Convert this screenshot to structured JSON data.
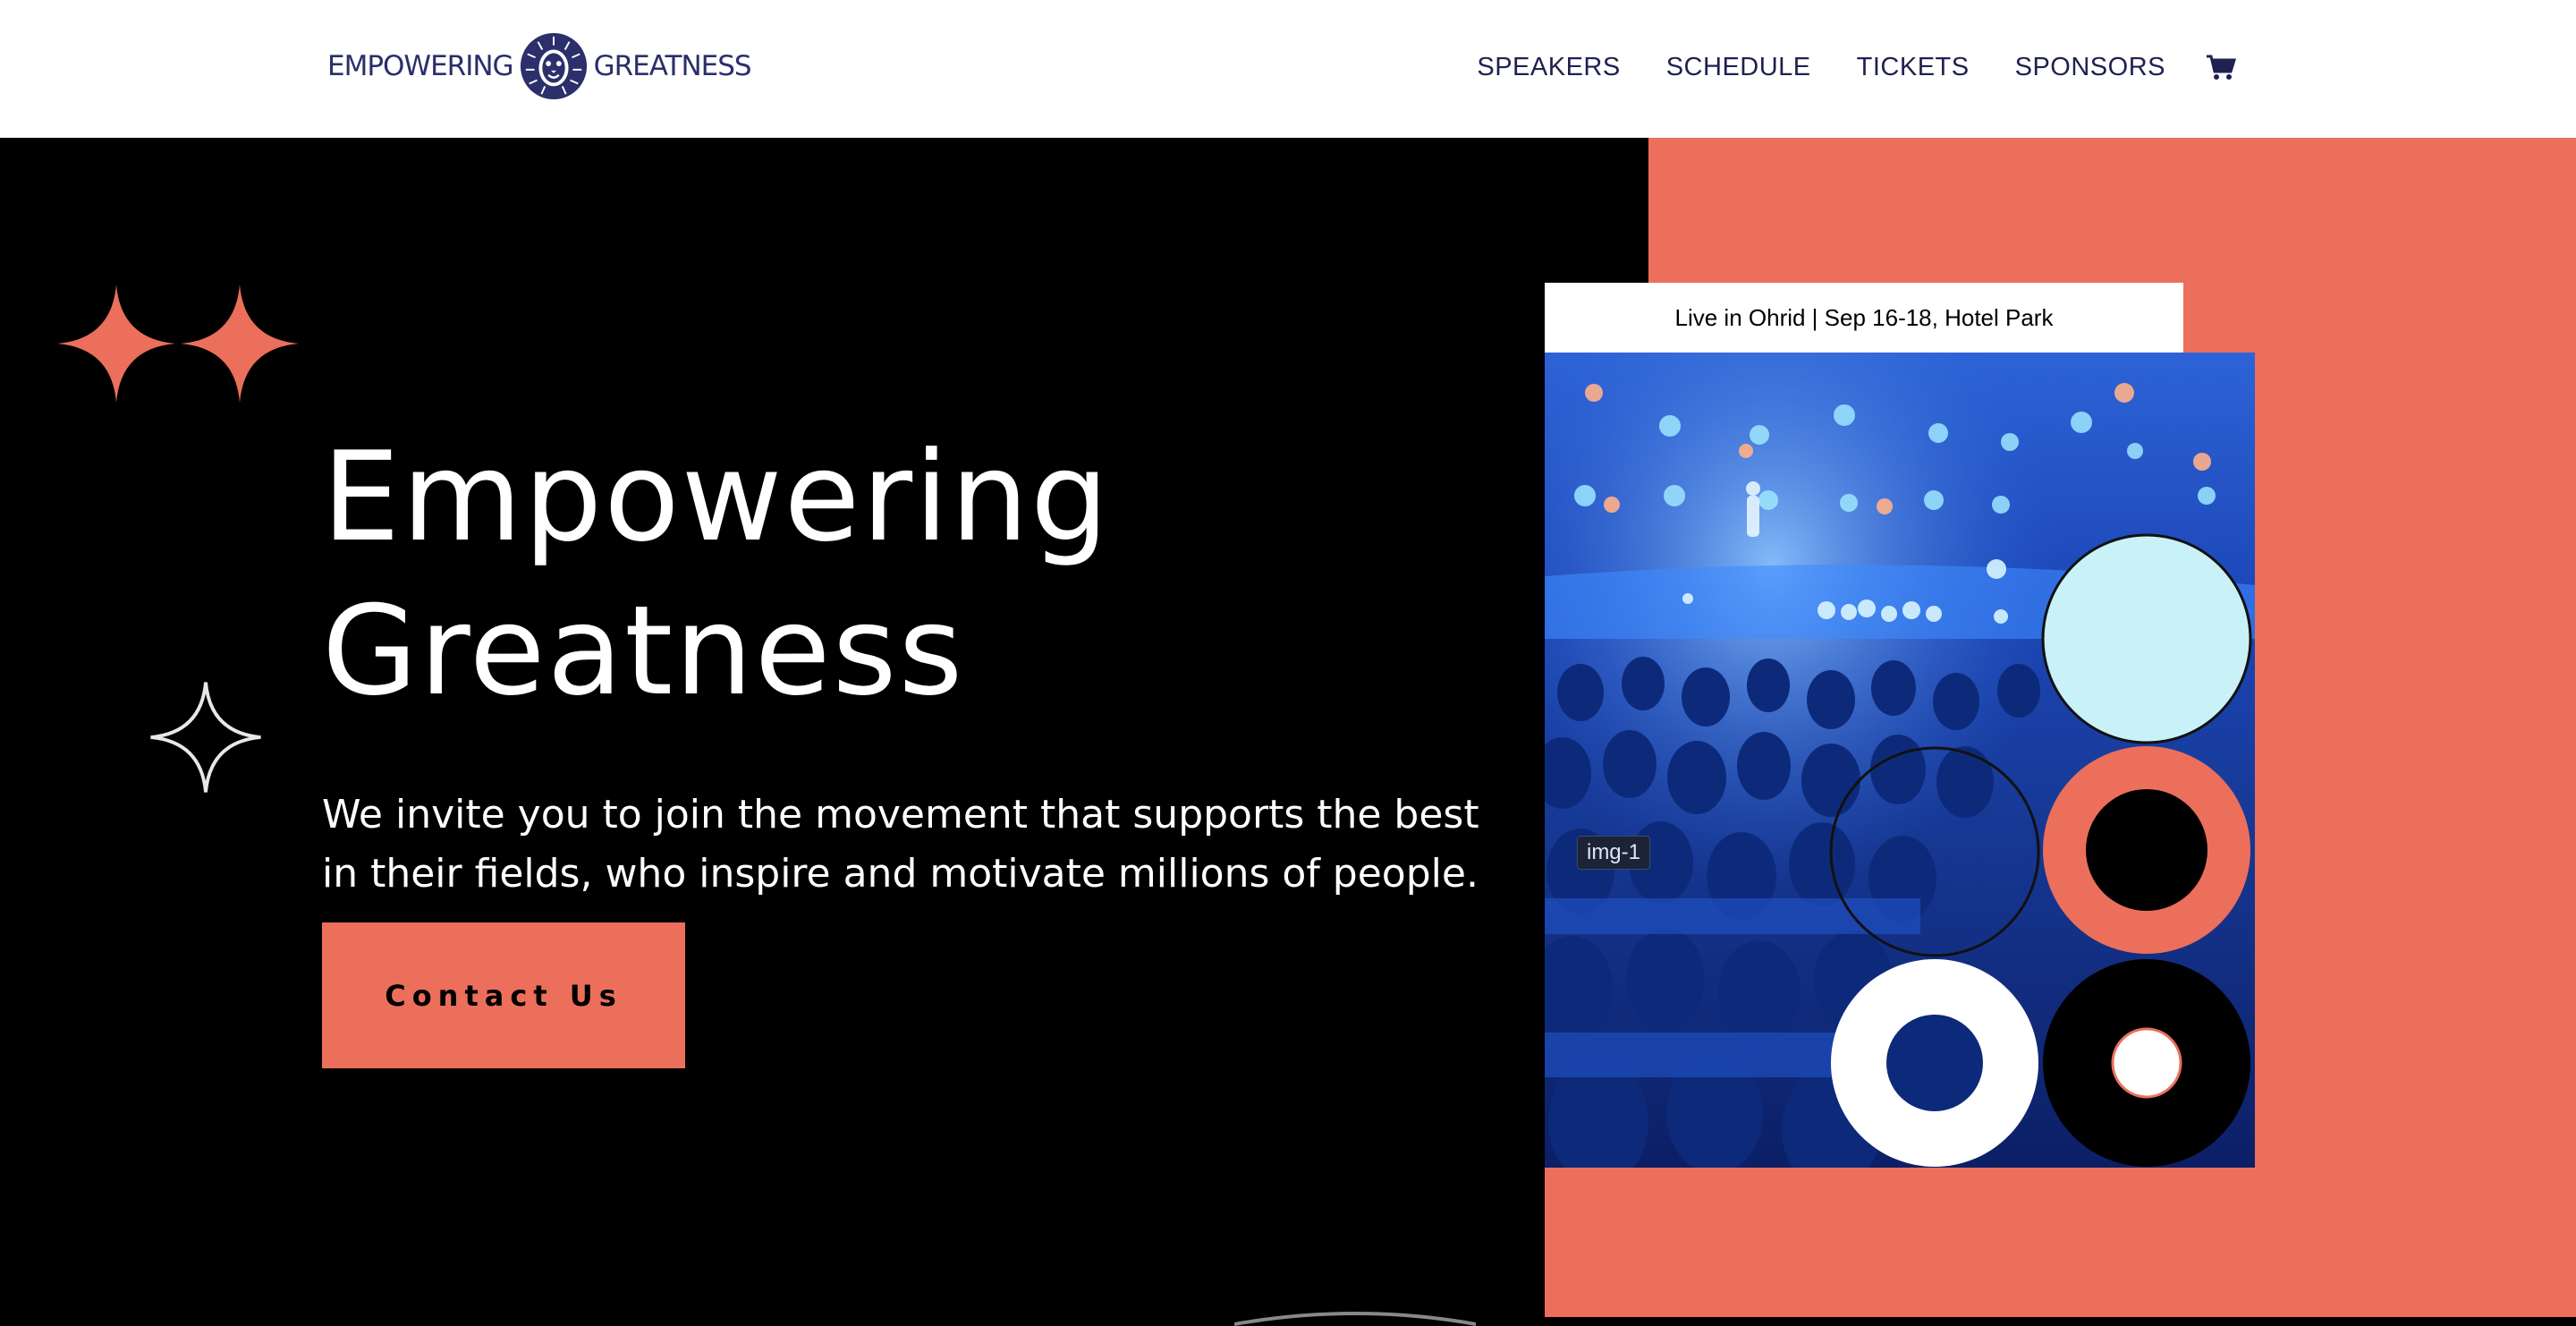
{
  "header": {
    "logo": {
      "left": "EMPOWERING",
      "right": "GREATNESS",
      "icon": "lion-icon"
    },
    "nav": [
      {
        "label": "SPEAKERS"
      },
      {
        "label": "SCHEDULE"
      },
      {
        "label": "TICKETS"
      },
      {
        "label": "SPONSORS"
      }
    ],
    "cart_icon": "cart-icon"
  },
  "hero": {
    "title_line1": "Empowering",
    "title_line2": "Greatness",
    "subtitle": "We invite you to join the movement that supports the best in their fields, who inspire and motivate millions of people.",
    "cta_label": "Contact Us",
    "event_info": "Live in Ohrid | Sep 16-18, Hotel Park",
    "image_tag": "img-1"
  },
  "colors": {
    "accent": "#ec6f5b",
    "dark": "#000000",
    "navy": "#1f2150",
    "light_blue": "#c8f1f8"
  }
}
